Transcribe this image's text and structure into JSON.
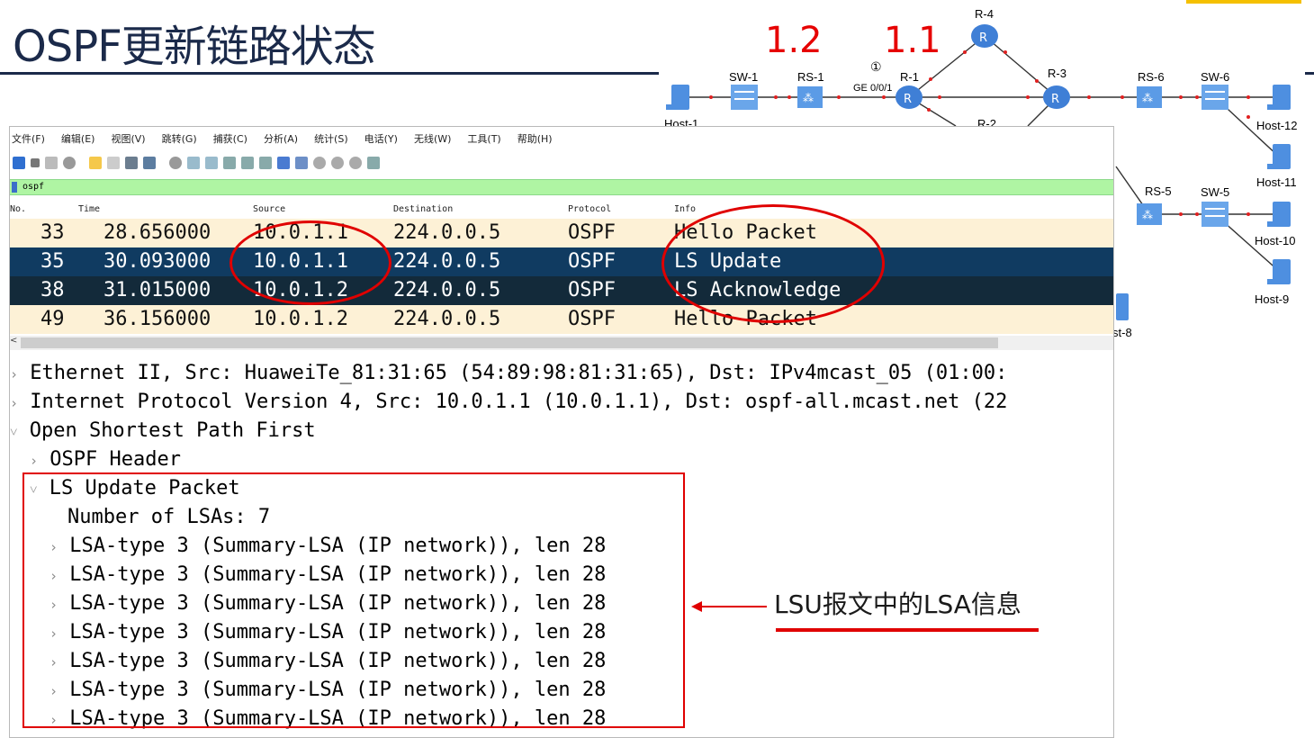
{
  "slide": {
    "title": "OSPF更新链路状态",
    "annotation": "LSU报文中的LSA信息"
  },
  "topology": {
    "ip_labels": [
      "1.2",
      "1.1"
    ],
    "interface_num": "①",
    "interface_label": "GE 0/0/1",
    "routers": [
      "R-4",
      "R-1",
      "R-3",
      "R-2"
    ],
    "switches": [
      "SW-1",
      "SW-6",
      "SW-5"
    ],
    "route_switches": [
      "RS-1",
      "RS-6",
      "RS-5"
    ],
    "hosts": [
      "Host-1",
      "Host-12",
      "Host-11",
      "Host-10",
      "Host-9",
      "st-8"
    ]
  },
  "wireshark": {
    "menu": [
      "文件(F)",
      "编辑(E)",
      "视图(V)",
      "跳转(G)",
      "捕获(C)",
      "分析(A)",
      "统计(S)",
      "电话(Y)",
      "无线(W)",
      "工具(T)",
      "帮助(H)"
    ],
    "filter": "ospf",
    "columns": [
      "No.",
      "Time",
      "Source",
      "Destination",
      "Protocol",
      "Info"
    ],
    "packets": [
      {
        "no": "33",
        "time": "28.656000",
        "source": "10.0.1.1",
        "destination": "224.0.0.5",
        "protocol": "OSPF",
        "info": "Hello Packet"
      },
      {
        "no": "35",
        "time": "30.093000",
        "source": "10.0.1.1",
        "destination": "224.0.0.5",
        "protocol": "OSPF",
        "info": "LS Update"
      },
      {
        "no": "38",
        "time": "31.015000",
        "source": "10.0.1.2",
        "destination": "224.0.0.5",
        "protocol": "OSPF",
        "info": "LS Acknowledge"
      },
      {
        "no": "49",
        "time": "36.156000",
        "source": "10.0.1.2",
        "destination": "224.0.0.5",
        "protocol": "OSPF",
        "info": "Hello Packet"
      }
    ],
    "scroll_left": "<",
    "details": {
      "ethernet": "Ethernet II, Src: HuaweiTe_81:31:65 (54:89:98:81:31:65), Dst: IPv4mcast_05 (01:00:",
      "ip": "Internet Protocol Version 4, Src: 10.0.1.1 (10.0.1.1), Dst: ospf-all.mcast.net (22",
      "ospf": "Open Shortest Path First",
      "ospf_header": "OSPF Header",
      "lsu_packet": "LS Update Packet",
      "num_lsas": "Number of LSAs: 7",
      "lsas": [
        "LSA-type 3 (Summary-LSA (IP network)), len 28",
        "LSA-type 3 (Summary-LSA (IP network)), len 28",
        "LSA-type 3 (Summary-LSA (IP network)), len 28",
        "LSA-type 3 (Summary-LSA (IP network)), len 28",
        "LSA-type 3 (Summary-LSA (IP network)), len 28",
        "LSA-type 3 (Summary-LSA (IP network)), len 28",
        "LSA-type 3 (Summary-LSA (IP network)), len 28"
      ]
    }
  },
  "colors": {
    "hello_row": "#fdf1d6",
    "selected_row": "#103b61",
    "ack_row": "#132a3a",
    "annotation_red": "#e00000",
    "filter_green": "#aff5a3"
  }
}
